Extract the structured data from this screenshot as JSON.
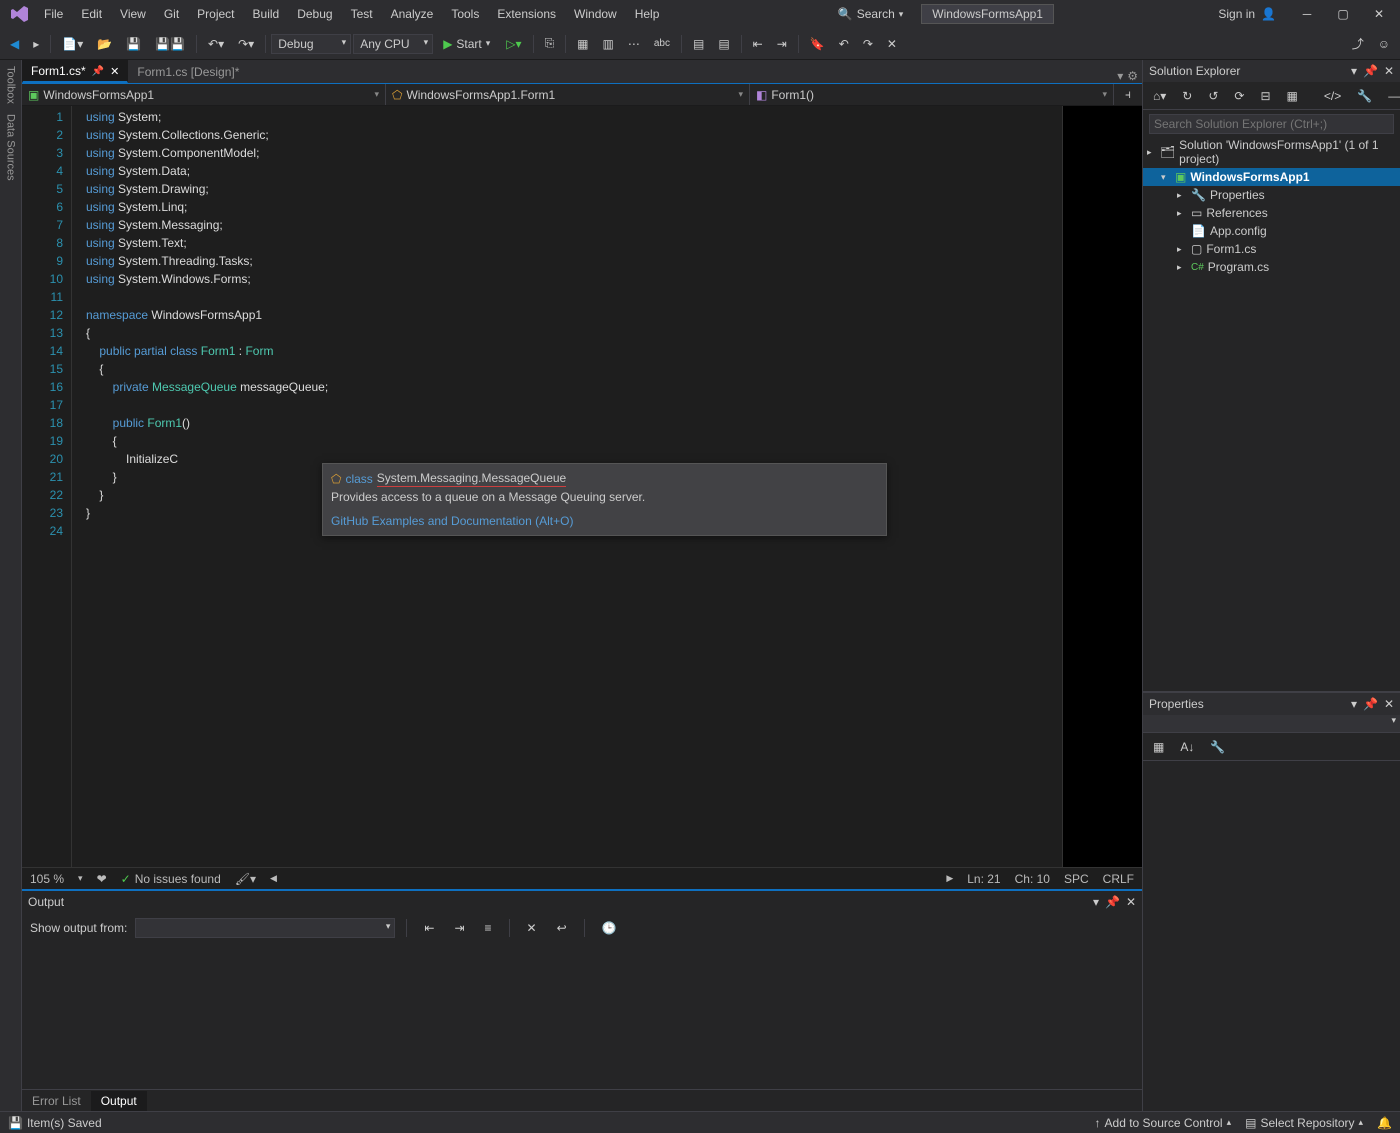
{
  "menu": [
    "File",
    "Edit",
    "View",
    "Git",
    "Project",
    "Build",
    "Debug",
    "Test",
    "Analyze",
    "Tools",
    "Extensions",
    "Window",
    "Help"
  ],
  "search_label": "Search",
  "app_title": "WindowsFormsApp1",
  "sign_in": "Sign in",
  "toolbar": {
    "config": "Debug",
    "platform": "Any CPU",
    "start": "Start"
  },
  "left_rail": [
    "Toolbox",
    "Data Sources"
  ],
  "tabs": [
    {
      "label": "Form1.cs*",
      "active": true
    },
    {
      "label": "Form1.cs [Design]*",
      "active": false
    }
  ],
  "nav": {
    "project": "WindowsFormsApp1",
    "class": "WindowsFormsApp1.Form1",
    "member": "Form1()"
  },
  "code_lines": [
    {
      "n": 1,
      "t": "using System;"
    },
    {
      "n": 2,
      "t": "using System.Collections.Generic;"
    },
    {
      "n": 3,
      "t": "using System.ComponentModel;"
    },
    {
      "n": 4,
      "t": "using System.Data;"
    },
    {
      "n": 5,
      "t": "using System.Drawing;"
    },
    {
      "n": 6,
      "t": "using System.Linq;"
    },
    {
      "n": 7,
      "t": "using System.Messaging;"
    },
    {
      "n": 8,
      "t": "using System.Text;"
    },
    {
      "n": 9,
      "t": "using System.Threading.Tasks;"
    },
    {
      "n": 10,
      "t": "using System.Windows.Forms;"
    },
    {
      "n": 11,
      "t": ""
    },
    {
      "n": 12,
      "t": "namespace WindowsFormsApp1"
    },
    {
      "n": 13,
      "t": "{"
    },
    {
      "n": 14,
      "t": "    public partial class Form1 : Form"
    },
    {
      "n": 15,
      "t": "    {"
    },
    {
      "n": 16,
      "t": "        private MessageQueue messageQueue;"
    },
    {
      "n": 17,
      "t": ""
    },
    {
      "n": 18,
      "t": "        public Form1()"
    },
    {
      "n": 19,
      "t": "        {"
    },
    {
      "n": 20,
      "t": "            InitializeC"
    },
    {
      "n": 21,
      "t": "        }"
    },
    {
      "n": 22,
      "t": "    }"
    },
    {
      "n": 23,
      "t": "}"
    },
    {
      "n": 24,
      "t": ""
    }
  ],
  "tooltip": {
    "kind": "class",
    "qname": "System.Messaging.MessageQueue",
    "desc": "Provides access to a queue on a Message Queuing server.",
    "link": "GitHub Examples and Documentation (Alt+O)"
  },
  "editor_status": {
    "zoom": "105 %",
    "issues": "No issues found",
    "ln": "Ln: 21",
    "ch": "Ch: 10",
    "ins": "SPC",
    "eol": "CRLF"
  },
  "output": {
    "title": "Output",
    "show_from": "Show output from:",
    "tabs": [
      "Error List",
      "Output"
    ],
    "active_tab": "Output"
  },
  "solution_explorer": {
    "title": "Solution Explorer",
    "search_placeholder": "Search Solution Explorer (Ctrl+;)",
    "root": "Solution 'WindowsFormsApp1' (1 of 1 project)",
    "project": "WindowsFormsApp1",
    "nodes": [
      "Properties",
      "References",
      "App.config",
      "Form1.cs",
      "Program.cs"
    ]
  },
  "properties": {
    "title": "Properties"
  },
  "statusbar": {
    "left": "Item(s) Saved",
    "source_control": "Add to Source Control",
    "repo": "Select Repository"
  }
}
